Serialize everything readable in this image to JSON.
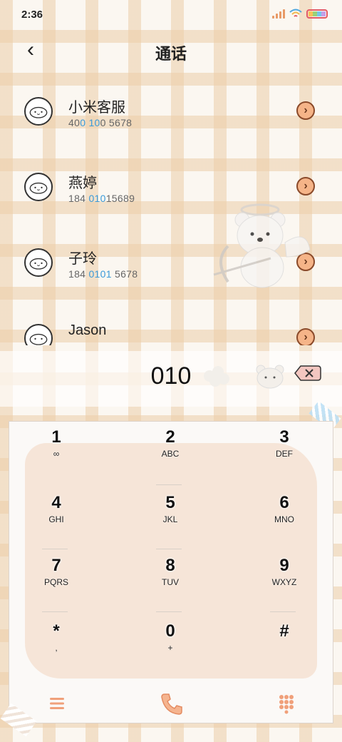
{
  "status": {
    "time": "2:36"
  },
  "header": {
    "back_icon": "chevron-left-icon",
    "title": "通话"
  },
  "contacts": [
    {
      "name": "小米客服",
      "num_parts": [
        "40",
        "0 10",
        "0 5678"
      ]
    },
    {
      "name": "燕婷",
      "num_parts": [
        "184 ",
        "010",
        "15689"
      ]
    },
    {
      "name": "子玲",
      "num_parts": [
        "184 ",
        "0101",
        " 5678"
      ]
    },
    {
      "name": "Jason",
      "num_parts": [
        "",
        "",
        ""
      ]
    }
  ],
  "dial": {
    "digits": "010"
  },
  "keypad": [
    {
      "digit": "1",
      "letters": "∞"
    },
    {
      "digit": "2",
      "letters": "ABC"
    },
    {
      "digit": "3",
      "letters": "DEF"
    },
    {
      "digit": "4",
      "letters": "GHI"
    },
    {
      "digit": "5",
      "letters": "JKL"
    },
    {
      "digit": "6",
      "letters": "MNO"
    },
    {
      "digit": "7",
      "letters": "PQRS"
    },
    {
      "digit": "8",
      "letters": "TUV"
    },
    {
      "digit": "9",
      "letters": "WXYZ"
    },
    {
      "digit": "*",
      "letters": ","
    },
    {
      "digit": "0",
      "letters": "+"
    },
    {
      "digit": "#",
      "letters": ""
    }
  ],
  "colors": {
    "accent": "#f0a07a",
    "highlight": "#3a9ad9"
  }
}
